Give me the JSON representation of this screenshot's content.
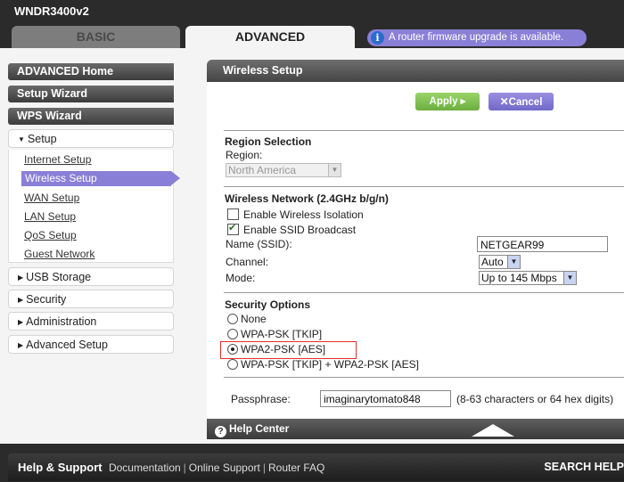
{
  "header": {
    "model": "WNDR3400v2",
    "tabs": [
      {
        "label": "BASIC"
      },
      {
        "label": "ADVANCED"
      }
    ],
    "notice": "A router firmware upgrade is available."
  },
  "sidebar": {
    "main": [
      {
        "label": "ADVANCED Home"
      },
      {
        "label": "Setup Wizard"
      },
      {
        "label": "WPS Wizard"
      }
    ],
    "setup": {
      "label": "Setup",
      "items": [
        {
          "label": "Internet Setup"
        },
        {
          "label": "Wireless Setup"
        },
        {
          "label": "WAN Setup"
        },
        {
          "label": "LAN Setup"
        },
        {
          "label": "QoS Setup"
        },
        {
          "label": "Guest Network"
        }
      ]
    },
    "collapsed": [
      {
        "label": "USB Storage"
      },
      {
        "label": "Security"
      },
      {
        "label": "Administration"
      },
      {
        "label": "Advanced Setup"
      }
    ]
  },
  "panel": {
    "title": "Wireless Setup",
    "apply_label": "Apply ▸",
    "cancel_label": "Cancel",
    "region": {
      "heading": "Region Selection",
      "label": "Region:",
      "value": "North America"
    },
    "wireless": {
      "heading": "Wireless Network (2.4GHz b/g/n)",
      "isolation_label": "Enable Wireless Isolation",
      "isolation_checked": false,
      "ssid_broadcast_label": "Enable SSID Broadcast",
      "ssid_broadcast_checked": true,
      "ssid_label": "Name (SSID):",
      "ssid_value": "NETGEAR99",
      "channel_label": "Channel:",
      "channel_value": "Auto",
      "mode_label": "Mode:",
      "mode_value": "Up to 145 Mbps"
    },
    "security": {
      "heading": "Security Options",
      "options": [
        {
          "label": "None",
          "selected": false
        },
        {
          "label": "WPA-PSK [TKIP]",
          "selected": false
        },
        {
          "label": "WPA2-PSK [AES]",
          "selected": true
        },
        {
          "label": "WPA-PSK [TKIP] + WPA2-PSK [AES]",
          "selected": false
        }
      ],
      "passphrase_label": "Passphrase:",
      "passphrase_value": "imaginarytomato848",
      "passphrase_hint": "(8-63 characters or 64 hex digits)"
    },
    "help_center": "Help Center"
  },
  "footer": {
    "title": "Help & Support",
    "links": [
      {
        "label": "Documentation"
      },
      {
        "label": "Online Support"
      },
      {
        "label": "Router FAQ"
      }
    ],
    "search": "SEARCH HELP"
  },
  "colors": {
    "accent_purple": "#8a7fd6",
    "apply_green": "#7cbf4c",
    "highlight_red": "#e0302a"
  }
}
